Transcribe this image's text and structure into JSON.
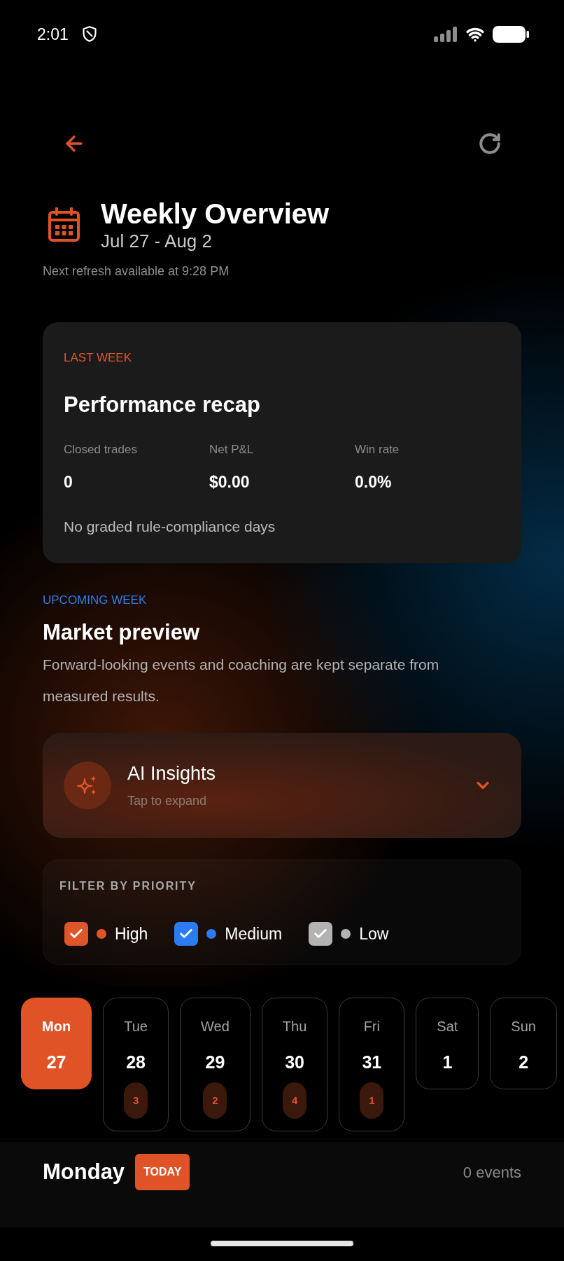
{
  "status_bar": {
    "time": "2:01"
  },
  "header": {
    "title": "Weekly Overview",
    "date_range": "Jul 27 - Aug 2",
    "refresh_note": "Next refresh available at 9:28 PM"
  },
  "recap": {
    "eyebrow": "LAST WEEK",
    "title": "Performance recap",
    "stats": [
      {
        "label": "Closed trades",
        "value": "0"
      },
      {
        "label": "Net P&L",
        "value": "$0.00"
      },
      {
        "label": "Win rate",
        "value": "0.0%"
      }
    ],
    "note": "No graded rule-compliance days"
  },
  "preview": {
    "eyebrow": "UPCOMING WEEK",
    "title": "Market preview",
    "description": "Forward-looking events and coaching are kept separate from measured results."
  },
  "ai_insights": {
    "title": "AI Insights",
    "subtitle": "Tap to expand",
    "expanded": false
  },
  "filter": {
    "title": "FILTER BY PRIORITY",
    "options": [
      {
        "label": "High",
        "checked": true,
        "color": "#e0562b"
      },
      {
        "label": "Medium",
        "checked": true,
        "color": "#2a7cf0"
      },
      {
        "label": "Low",
        "checked": true,
        "color": "#b3b3b3"
      }
    ]
  },
  "days": [
    {
      "weekday": "Mon",
      "date": "27",
      "selected": true
    },
    {
      "weekday": "Tue",
      "date": "28",
      "selected": false,
      "count": "3"
    },
    {
      "weekday": "Wed",
      "date": "29",
      "selected": false,
      "count": "2"
    },
    {
      "weekday": "Thu",
      "date": "30",
      "selected": false,
      "count": "4"
    },
    {
      "weekday": "Fri",
      "date": "31",
      "selected": false,
      "count": "1"
    },
    {
      "weekday": "Sat",
      "date": "1",
      "selected": false
    },
    {
      "weekday": "Sun",
      "date": "2",
      "selected": false
    }
  ],
  "day_detail": {
    "title": "Monday",
    "badge": "TODAY",
    "event_count": "0 events"
  }
}
